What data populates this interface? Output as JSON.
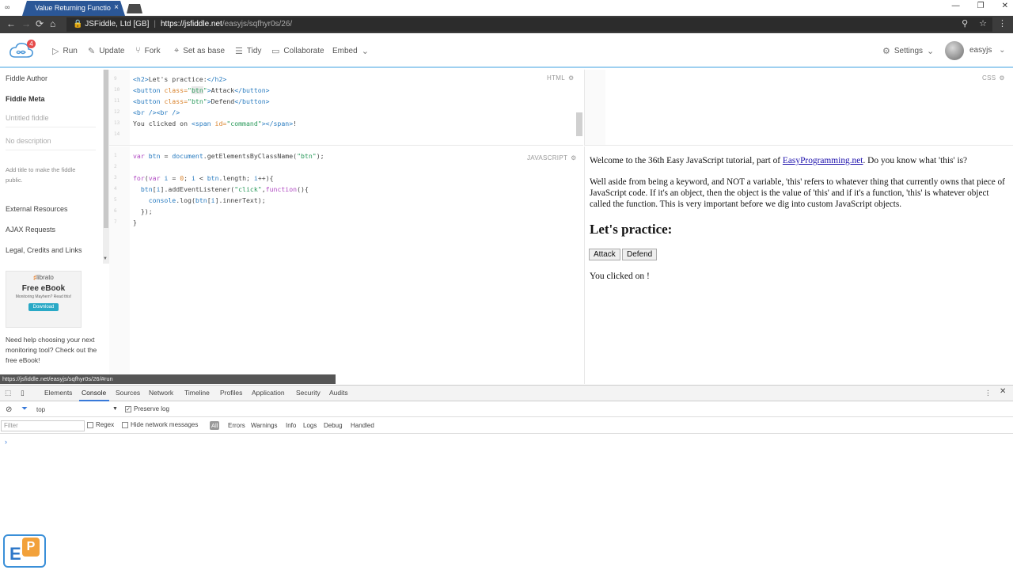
{
  "browser": {
    "tab_title": "Value Returning Functio",
    "tab_close": "×",
    "site_identity": "JSFiddle, Ltd [GB]",
    "url_host": "https://jsfiddle.net",
    "url_path": "/easyjs/sqfhyr0s/26/",
    "window_controls": [
      "—",
      "❐",
      "✕"
    ]
  },
  "header": {
    "notification_count": "4",
    "buttons": {
      "run": "Run",
      "update": "Update",
      "fork": "Fork",
      "set_as_base": "Set as base",
      "tidy": "Tidy",
      "collaborate": "Collaborate",
      "embed": "Embed",
      "settings": "Settings"
    },
    "username": "easyjs"
  },
  "sidebar": {
    "fiddle_author": "Fiddle Author",
    "fiddle_meta": "Fiddle Meta",
    "title_placeholder": "Untitled fiddle",
    "description_placeholder": "No description",
    "public_hint": "Add title to make the fiddle public.",
    "external_resources": "External Resources",
    "ajax_requests": "AJAX Requests",
    "legal": "Legal, Credits and Links",
    "ad": {
      "brand": "librato",
      "title": "Free eBook",
      "subtitle": "Monitoring Mayhem? Read this!",
      "button": "Download"
    },
    "ad_text": "Need help choosing your next monitoring tool? Check out the free eBook!"
  },
  "panels": {
    "html_label": "HTML",
    "css_label": "CSS",
    "js_label": "JAVASCRIPT"
  },
  "html_code": {
    "line_numbers": [
      "9",
      "10",
      "11",
      "12",
      "13",
      "14"
    ]
  },
  "js_code": {
    "line_numbers": [
      "1",
      "2",
      "3",
      "4",
      "5",
      "6",
      "7"
    ]
  },
  "result": {
    "p1_before": "Welcome to the 36th Easy JavaScript tutorial, part of ",
    "p1_link": "EasyProgramming.net",
    "p1_after": ". Do you know what 'this' is?",
    "p2": "Well aside from being a keyword, and NOT a variable, 'this' refers to whatever thing that currently owns that piece of JavaScript code. If it's an object, then the object is the value of 'this' and if it's a function, 'this' is whatever object called the function. This is very important before we dig into custom JavaScript objects.",
    "heading": "Let's practice:",
    "button_attack": "Attack",
    "button_defend": "Defend",
    "clicked_text": "You clicked on !"
  },
  "status_url": "https://jsfiddle.net/easyjs/sqfhyr0s/26/#run",
  "devtools": {
    "tabs": [
      "Elements",
      "Console",
      "Sources",
      "Network",
      "Timeline",
      "Profiles",
      "Application",
      "Security",
      "Audits"
    ],
    "context": "top",
    "preserve_log": "Preserve log",
    "filter_placeholder": "Filter",
    "regex": "Regex",
    "hide_network": "Hide network messages",
    "levels": {
      "all": "All",
      "errors": "Errors",
      "warnings": "Warnings",
      "info": "Info",
      "logs": "Logs",
      "debug": "Debug",
      "handled": "Handled"
    },
    "prompt": "›"
  },
  "colors": {
    "tab_active": "#2b5797",
    "accent_blue": "#3879d9",
    "link": "#1a0dab"
  }
}
